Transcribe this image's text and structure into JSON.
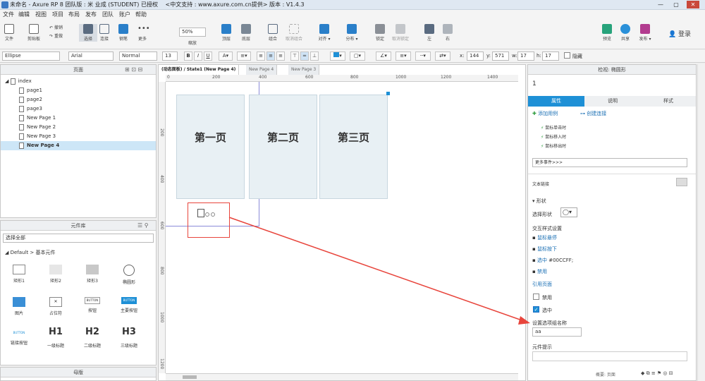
{
  "titlebar": {
    "title": "未命名 - Axure RP 8 团队版 : 米 业成 (STUDENT) 已授权　 <中文支持 : www.axure.com.cn提供> 版本 : V1.4.3",
    "buttons": [
      "—",
      "▢",
      "✕"
    ]
  },
  "menu": [
    "文件",
    "编辑",
    "视图",
    "项目",
    "布局",
    "发布",
    "团队",
    "账户",
    "帮助"
  ],
  "toolbar": {
    "file": "文件",
    "clipboard": "剪贴板",
    "undo": "撤销",
    "redo": "重做",
    "select": "选择",
    "connect": "连接",
    "pen": "钢笔",
    "more": "更多",
    "zoom_value": "50%",
    "zoom": "缩放",
    "top": "顶层",
    "bottom": "底层",
    "group": "组合",
    "ungroup": "取消组合",
    "align": "对齐",
    "distribute": "分布",
    "lock": "锁定",
    "unlock": "取消锁定",
    "left": "左",
    "right": "右",
    "preview": "预览",
    "share": "共享",
    "publish": "发布",
    "login": "登录"
  },
  "formatbar": {
    "shape": "Ellipse",
    "font": "Arial",
    "weight": "Normal",
    "size": "13",
    "x_label": "x:",
    "x": "144",
    "y_label": "y:",
    "y": "571",
    "w_label": "w:",
    "w": "17",
    "h_label": "h:",
    "h": "17",
    "hidden": "隐藏"
  },
  "pages": {
    "header": "页面",
    "items": [
      "index",
      "page1",
      "page2",
      "page3",
      "New Page 1",
      "New Page 2",
      "New Page 3",
      "New Page 4"
    ]
  },
  "library": {
    "header": "元件库",
    "filter": "选择全部",
    "group": "Default > 基本元件",
    "items": [
      "矩形1",
      "矩形2",
      "矩形3",
      "椭圆形",
      "图片",
      "占位符",
      "按钮",
      "主要按钮",
      "链接按钮",
      "一级标题",
      "二级标题",
      "三级标题"
    ],
    "btn_text": "BUTTON",
    "h1": "H1",
    "h2": "H2",
    "h3": "H3"
  },
  "masters": {
    "header": "母版"
  },
  "canvas": {
    "tabs": [
      "(动态面板) / State1 (New Page 4)",
      "New Page 4",
      "New Page 3"
    ],
    "ruler_h": [
      "0",
      "200",
      "400",
      "600",
      "800",
      "1000",
      "1200",
      "1400"
    ],
    "ruler_v": [
      "200",
      "400",
      "600",
      "800",
      "1000",
      "1200"
    ],
    "boxes": [
      "第一页",
      "第二页",
      "第三页"
    ]
  },
  "inspector": {
    "title": "检视: 椭圆形",
    "name": "1",
    "tabs": [
      "属性",
      "说明",
      "样式"
    ],
    "add_case": "添加用例",
    "create_link": "创建连接",
    "events": [
      "鼠标单击时",
      "鼠标移入时",
      "鼠标移出时"
    ],
    "more_events": "更多事件>>>",
    "text_link": "文本链接",
    "shape_section": "形状",
    "choose_shape": "选择形状",
    "interaction_style": "交互样式设置",
    "hover": "鼠标悬停",
    "mousedown": "鼠标按下",
    "selected": "选中",
    "selected_color": "#00CCFF;",
    "disabled": "禁用",
    "ref_page": "引用页面",
    "disabled_cb": "禁用",
    "selected_cb": "选中",
    "group_name_label": "设置选项组名称",
    "group_name_value": "aa",
    "tooltip_label": "元件提示"
  },
  "statusbar": {
    "text": "概要: 页面"
  },
  "colors": {
    "accent": "#1e90d6",
    "arrow": "#e8453c"
  }
}
